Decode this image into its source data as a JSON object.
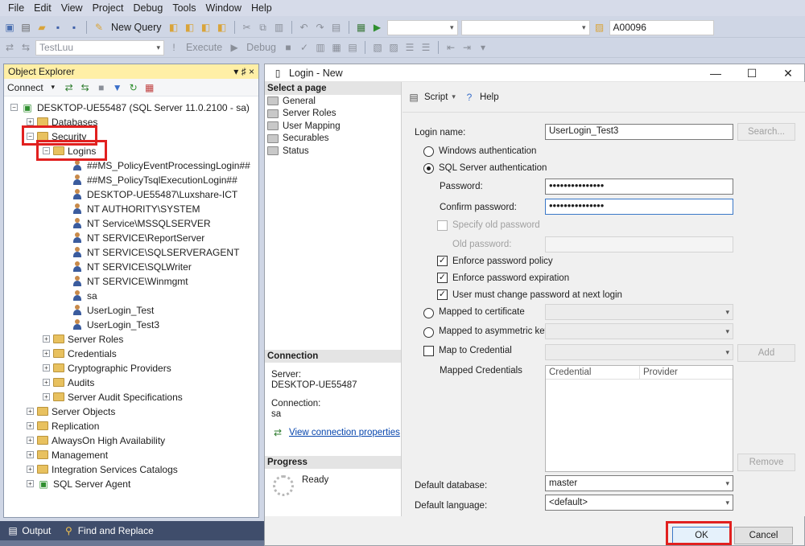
{
  "menu": [
    "File",
    "Edit",
    "View",
    "Project",
    "Debug",
    "Tools",
    "Window",
    "Help"
  ],
  "toolbar1": {
    "new_query": "New Query",
    "right_combo_value": "A00096"
  },
  "toolbar2": {
    "db_combo": "TestLuu",
    "execute": "Execute",
    "debug": "Debug"
  },
  "object_explorer": {
    "title": "Object Explorer",
    "pin": "▾ ♯ ×",
    "connect": "Connect",
    "server": "DESKTOP-UE55487 (SQL Server 11.0.2100 - sa)",
    "nodes": {
      "databases": "Databases",
      "security": "Security",
      "logins": "Logins",
      "server_roles": "Server Roles",
      "credentials": "Credentials",
      "crypto": "Cryptographic Providers",
      "audits": "Audits",
      "audit_specs": "Server Audit Specifications",
      "server_objects": "Server Objects",
      "replication": "Replication",
      "alwayson": "AlwaysOn High Availability",
      "management": "Management",
      "integration": "Integration Services Catalogs",
      "agent": "SQL Server Agent"
    },
    "logins": [
      "##MS_PolicyEventProcessingLogin##",
      "##MS_PolicyTsqlExecutionLogin##",
      "DESKTOP-UE55487\\Luxshare-ICT",
      "NT AUTHORITY\\SYSTEM",
      "NT Service\\MSSQLSERVER",
      "NT SERVICE\\ReportServer",
      "NT SERVICE\\SQLSERVERAGENT",
      "NT SERVICE\\SQLWriter",
      "NT SERVICE\\Winmgmt",
      "sa",
      "UserLogin_Test",
      "UserLogin_Test3"
    ]
  },
  "bottom_tabs": {
    "output": "Output",
    "find": "Find and Replace"
  },
  "dialog": {
    "title": "Login - New",
    "select_page": "Select a page",
    "pages": [
      "General",
      "Server Roles",
      "User Mapping",
      "Securables",
      "Status"
    ],
    "connection_hdr": "Connection",
    "server_label": "Server:",
    "server_value": "DESKTOP-UE55487",
    "connection_label": "Connection:",
    "connection_value": "sa",
    "view_conn": "View connection properties",
    "progress_hdr": "Progress",
    "progress_status": "Ready",
    "script": "Script",
    "help": "Help",
    "login_name_label": "Login name:",
    "login_name_value": "UserLogin_Test3",
    "search": "Search...",
    "windows_auth": "Windows authentication",
    "sql_auth": "SQL Server authentication",
    "password_label": "Password:",
    "password_value": "•••••••••••••••",
    "confirm_label": "Confirm password:",
    "confirm_value": "•••••••••••••••",
    "specify_old": "Specify old password",
    "old_password": "Old password:",
    "enforce_policy": "Enforce password policy",
    "enforce_expiration": "Enforce password expiration",
    "must_change": "User must change password at next login",
    "mapped_cert": "Mapped to certificate",
    "mapped_asym": "Mapped to asymmetric key",
    "map_credential": "Map to Credential",
    "add": "Add",
    "mapped_credentials": "Mapped Credentials",
    "col_credential": "Credential",
    "col_provider": "Provider",
    "remove": "Remove",
    "default_db_label": "Default database:",
    "default_db_value": "master",
    "default_lang_label": "Default language:",
    "default_lang_value": "<default>",
    "ok": "OK",
    "cancel": "Cancel",
    "minimize": "—",
    "maximize": "☐",
    "close": "✕"
  }
}
